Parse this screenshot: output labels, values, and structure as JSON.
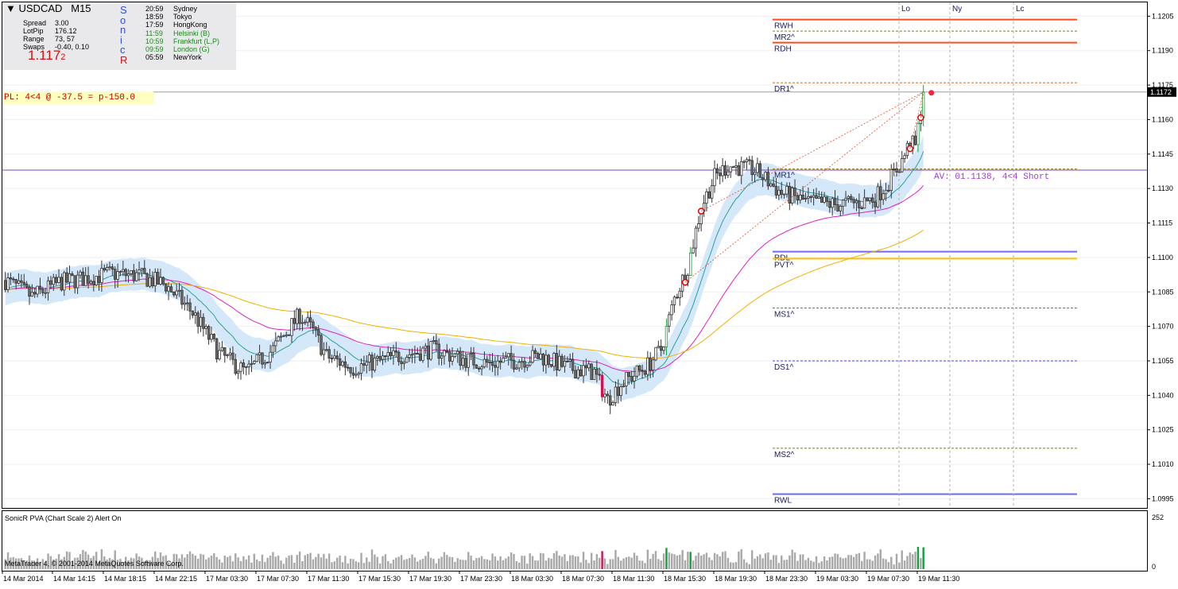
{
  "window": {
    "symbol": "USDCAD",
    "timeframe": "M15",
    "bid_main": "1.117",
    "bid_small": "2",
    "stats": [
      {
        "label": "Spread",
        "value": "3.00"
      },
      {
        "label": "LotPip",
        "value": "176.12"
      },
      {
        "label": "Range",
        "value": "73, 57"
      },
      {
        "label": "Swaps",
        "value": "-0.40, 0.10"
      }
    ],
    "sonic_letters": [
      "S",
      "o",
      "n",
      "i",
      "c",
      "R"
    ],
    "sessions": [
      {
        "time": "20:59",
        "name": "Sydney",
        "status": "closed"
      },
      {
        "time": "18:59",
        "name": "Tokyo",
        "status": "closed"
      },
      {
        "time": "17:59",
        "name": "HongKong",
        "status": "closed"
      },
      {
        "time": "11:59",
        "name": "Helsinki  (B)",
        "status": "open"
      },
      {
        "time": "10:59",
        "name": "Frankfurt  (L,P)",
        "status": "open"
      },
      {
        "time": "09:59",
        "name": "London  (G)",
        "status": "open"
      },
      {
        "time": "05:59",
        "name": "NewYork",
        "status": "closed"
      }
    ]
  },
  "pl_label": "PL: 4<4 @ -37.5 = p-150.0",
  "av_label": "AV: 01.1138, 4<4 Short",
  "current_price_tag": "1.1172",
  "session_markers": [
    "Lo",
    "Ny",
    "Lc"
  ],
  "levels": [
    {
      "name": "RWH",
      "price": 1.12035,
      "style": "solid",
      "color": "#ff4c1c"
    },
    {
      "name": "MR2^",
      "price": 1.11985,
      "style": "dashed",
      "color": "#8b7d00"
    },
    {
      "name": "RDH",
      "price": 1.11935,
      "style": "solid",
      "color": "#ff4c1c"
    },
    {
      "name": "DR1^",
      "price": 1.1176,
      "style": "dashed",
      "color": "#d2691e"
    },
    {
      "name": "MR1^",
      "price": 1.11385,
      "style": "dashed",
      "color": "#8b7d00"
    },
    {
      "name": "RDL",
      "price": 1.11025,
      "style": "solid",
      "color": "#6a6aff"
    },
    {
      "name": "PVT^",
      "price": 1.10995,
      "style": "solid",
      "color": "#ffc000"
    },
    {
      "name": "MS1^",
      "price": 1.1078,
      "style": "dashed",
      "color": "#8b7d00"
    },
    {
      "name": "DS1^",
      "price": 1.1055,
      "style": "dashed",
      "color": "#3c3cff"
    },
    {
      "name": "MS2^",
      "price": 1.1017,
      "style": "dashed",
      "color": "#8b7d00"
    },
    {
      "name": "RWL",
      "price": 1.0997,
      "style": "solid",
      "color": "#6a6aff"
    }
  ],
  "indicator_title": "SonicR PVA  (Chart Scale 2)   Alert On",
  "copyright": "MetaTrader 4, © 2001-2014 MetaQuotes Software Corp.",
  "volume_axis": {
    "max_label": "252",
    "min_label": "0"
  },
  "chart_data": {
    "type": "candlestick",
    "symbol": "USDCAD",
    "timeframe": "M15",
    "y_ticks": [
      "1.1205",
      "1.1190",
      "1.1175",
      "1.1160",
      "1.1145",
      "1.1130",
      "1.1115",
      "1.1100",
      "1.1085",
      "1.1070",
      "1.1055",
      "1.1040",
      "1.1025",
      "1.1010",
      "1.0995"
    ],
    "ylim": [
      1.0991,
      1.1211
    ],
    "x_ticks": [
      "14 Mar 2014",
      "14 Mar 14:15",
      "14 Mar 18:15",
      "14 Mar 22:15",
      "17 Mar 03:30",
      "17 Mar 07:30",
      "17 Mar 11:30",
      "17 Mar 15:30",
      "17 Mar 19:30",
      "17 Mar 23:30",
      "18 Mar 03:30",
      "18 Mar 07:30",
      "18 Mar 11:30",
      "18 Mar 15:30",
      "18 Mar 19:30",
      "18 Mar 23:30",
      "19 Mar 03:30",
      "19 Mar 07:30",
      "19 Mar 11:30"
    ],
    "current_price": 1.1172,
    "price_path": [
      [
        0,
        1.109
      ],
      [
        10,
        1.1083
      ],
      [
        20,
        1.1089
      ],
      [
        30,
        1.1091
      ],
      [
        40,
        1.1093
      ],
      [
        50,
        1.1092
      ],
      [
        60,
        1.1088
      ],
      [
        70,
        1.1076
      ],
      [
        80,
        1.1058
      ],
      [
        90,
        1.105
      ],
      [
        100,
        1.106
      ],
      [
        110,
        1.1075
      ],
      [
        115,
        1.1068
      ],
      [
        120,
        1.1057
      ],
      [
        130,
        1.1052
      ],
      [
        140,
        1.1055
      ],
      [
        150,
        1.1058
      ],
      [
        160,
        1.106
      ],
      [
        170,
        1.1056
      ],
      [
        180,
        1.1054
      ],
      [
        190,
        1.1055
      ],
      [
        200,
        1.1057
      ],
      [
        210,
        1.1052
      ],
      [
        220,
        1.105
      ],
      [
        225,
        1.1038
      ],
      [
        230,
        1.1045
      ],
      [
        240,
        1.1053
      ],
      [
        245,
        1.106
      ],
      [
        250,
        1.1082
      ],
      [
        255,
        1.1096
      ],
      [
        260,
        1.1122
      ],
      [
        265,
        1.1135
      ],
      [
        270,
        1.114
      ],
      [
        280,
        1.1138
      ],
      [
        290,
        1.1128
      ],
      [
        300,
        1.1124
      ],
      [
        310,
        1.1123
      ],
      [
        320,
        1.1124
      ],
      [
        325,
        1.1126
      ],
      [
        330,
        1.1133
      ],
      [
        335,
        1.1142
      ],
      [
        338,
        1.115
      ],
      [
        340,
        1.1148
      ],
      [
        343,
        1.1172
      ]
    ]
  }
}
